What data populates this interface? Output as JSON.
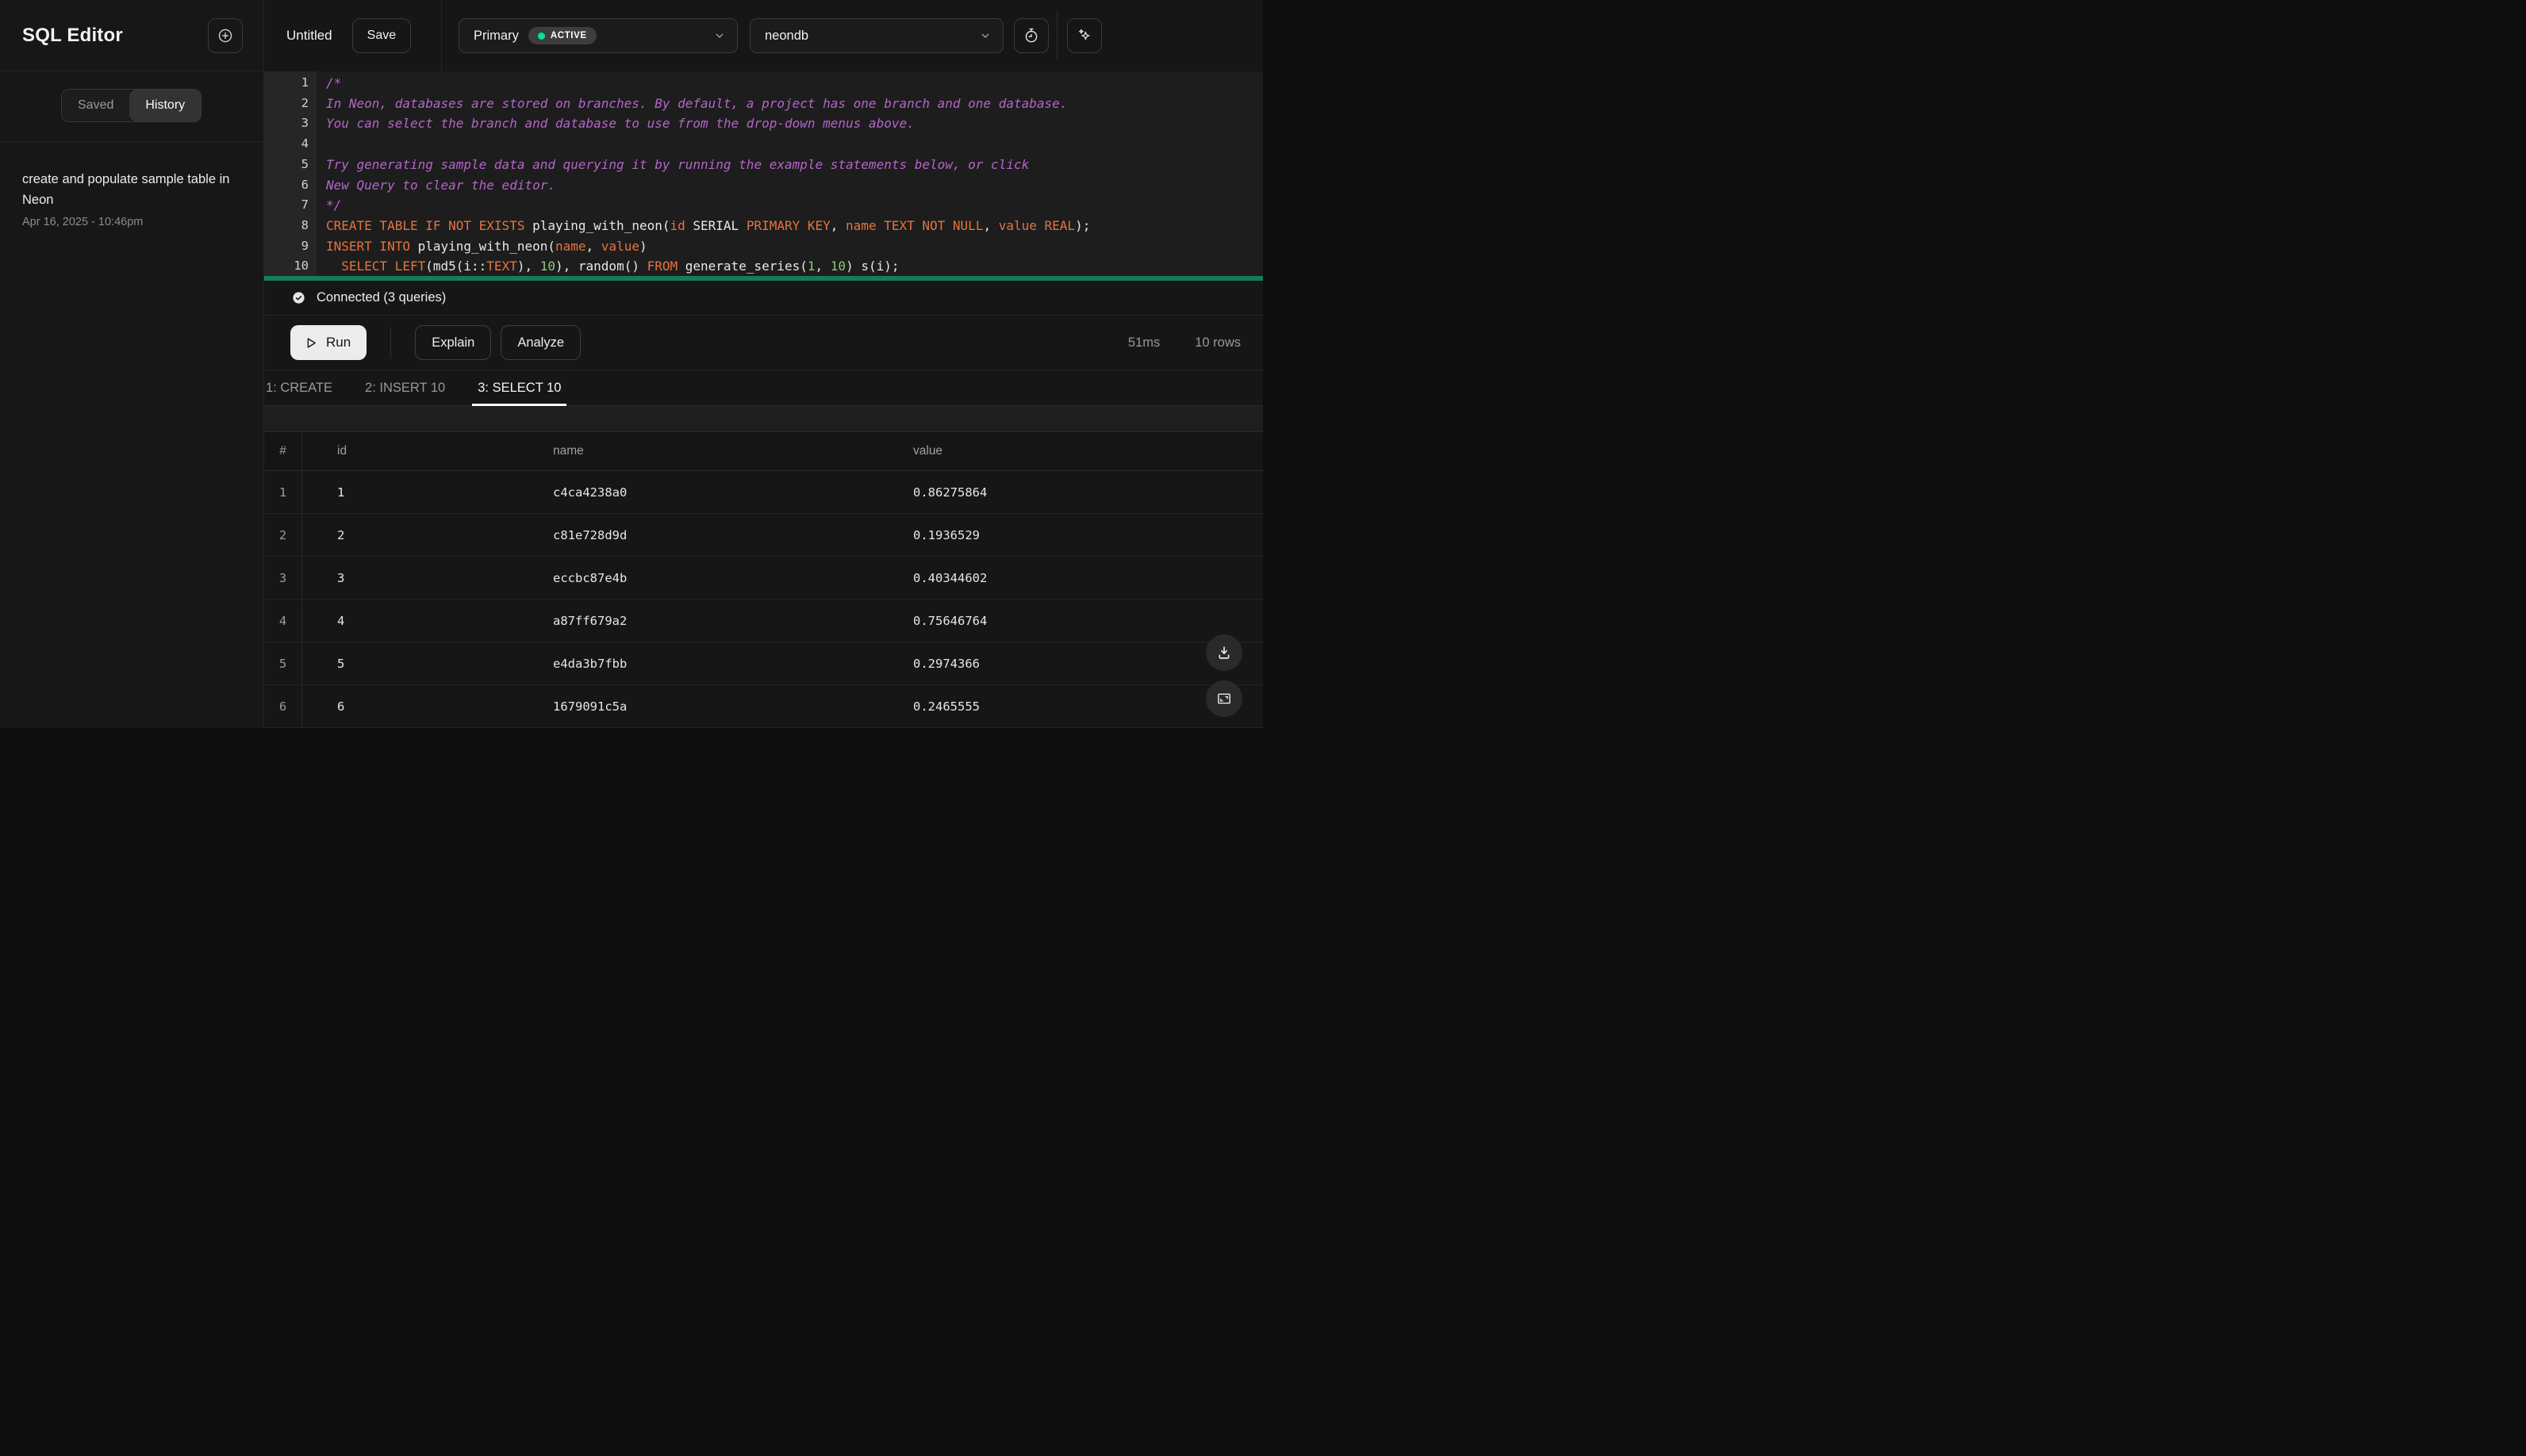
{
  "colors": {
    "accent_green": "#00e599",
    "splitter_green": "#157d55",
    "keyword": "#e5743f",
    "comment": "#b565c9",
    "number": "#8fc775",
    "panel": "#171717",
    "editor_bg": "#1d1d1d"
  },
  "sidebar": {
    "title": "SQL Editor",
    "tabs": [
      {
        "label": "Saved",
        "active": false
      },
      {
        "label": "History",
        "active": true
      }
    ],
    "history": [
      {
        "title": "create and populate sample table in Neon",
        "timestamp": "Apr 16, 2025 - 10:46pm"
      }
    ]
  },
  "topbar": {
    "query_name": "Untitled",
    "save_label": "Save",
    "branch": {
      "name": "Primary",
      "status": "ACTIVE",
      "status_color": "#00e599"
    },
    "database": {
      "name": "neondb"
    }
  },
  "icons": {
    "new_query": "plus-circle",
    "branch_chevron": "chevron-down",
    "database_chevron": "chevron-down",
    "timer": "stopwatch",
    "assist": "sparkles",
    "connected": "check-circle",
    "run": "play-outline",
    "download": "download-tray",
    "expand": "fullscreen-corners"
  },
  "editor": {
    "lines": [
      {
        "num": "1",
        "tokens": [
          [
            "/*",
            "c"
          ]
        ]
      },
      {
        "num": "2",
        "tokens": [
          [
            "In Neon, databases are stored on branches. By default, a project has one branch and one database.",
            "c"
          ]
        ]
      },
      {
        "num": "3",
        "tokens": [
          [
            "You can select the branch and database to use from the drop-down menus above.",
            "c"
          ]
        ]
      },
      {
        "num": "4",
        "tokens": []
      },
      {
        "num": "5",
        "tokens": [
          [
            "Try generating sample data and querying it by running the example statements below, or click",
            "c"
          ]
        ]
      },
      {
        "num": "6",
        "tokens": [
          [
            "New Query to clear the editor.",
            "c"
          ]
        ]
      },
      {
        "num": "7",
        "tokens": [
          [
            "*/",
            "c"
          ]
        ]
      },
      {
        "num": "8",
        "tokens": [
          [
            "CREATE TABLE IF NOT EXISTS",
            "k"
          ],
          [
            " playing_with_neon(",
            "p"
          ],
          [
            "id",
            "k"
          ],
          [
            " SERIAL ",
            "p"
          ],
          [
            "PRIMARY KEY",
            "k"
          ],
          [
            ", ",
            "p"
          ],
          [
            "name",
            "k"
          ],
          [
            " ",
            "p"
          ],
          [
            "TEXT NOT NULL",
            "k"
          ],
          [
            ", ",
            "p"
          ],
          [
            "value",
            "k"
          ],
          [
            " ",
            "p"
          ],
          [
            "REAL",
            "k"
          ],
          [
            ");",
            "p"
          ]
        ]
      },
      {
        "num": "9",
        "tokens": [
          [
            "INSERT INTO",
            "k"
          ],
          [
            " playing_with_neon(",
            "p"
          ],
          [
            "name",
            "k"
          ],
          [
            ", ",
            "p"
          ],
          [
            "value",
            "k"
          ],
          [
            ")",
            "p"
          ]
        ]
      },
      {
        "num": "10",
        "tokens": [
          [
            "  ",
            "p"
          ],
          [
            "SELECT LEFT",
            "k"
          ],
          [
            "(md5(i::",
            "p"
          ],
          [
            "TEXT",
            "k"
          ],
          [
            "), ",
            "p"
          ],
          [
            "10",
            "n"
          ],
          [
            "), random() ",
            "p"
          ],
          [
            "FROM",
            "k"
          ],
          [
            " generate_series(",
            "p"
          ],
          [
            "1",
            "n"
          ],
          [
            ", ",
            "p"
          ],
          [
            "10",
            "n"
          ],
          [
            ") s(i);",
            "p"
          ]
        ]
      }
    ]
  },
  "status": {
    "connected_label": "Connected (3 queries)"
  },
  "toolbar": {
    "run_label": "Run",
    "explain_label": "Explain",
    "analyze_label": "Analyze",
    "duration": "51ms",
    "row_count": "10 rows"
  },
  "result_tabs": [
    {
      "label": "1: CREATE",
      "active": false
    },
    {
      "label": "2: INSERT 10",
      "active": false
    },
    {
      "label": "3: SELECT 10",
      "active": true
    }
  ],
  "table": {
    "columns": [
      "#",
      "id",
      "name",
      "value"
    ],
    "rows": [
      [
        "1",
        "1",
        "c4ca4238a0",
        "0.86275864"
      ],
      [
        "2",
        "2",
        "c81e728d9d",
        "0.1936529"
      ],
      [
        "3",
        "3",
        "eccbc87e4b",
        "0.40344602"
      ],
      [
        "4",
        "4",
        "a87ff679a2",
        "0.75646764"
      ],
      [
        "5",
        "5",
        "e4da3b7fbb",
        "0.2974366"
      ],
      [
        "6",
        "6",
        "1679091c5a",
        "0.2465555"
      ]
    ]
  }
}
